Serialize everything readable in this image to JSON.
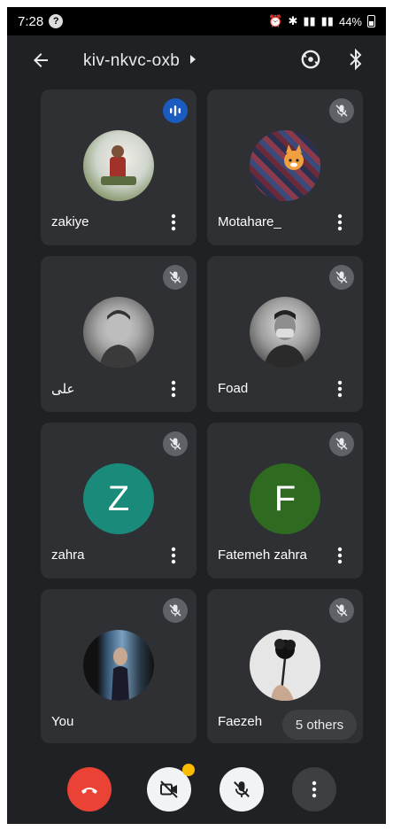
{
  "status_bar": {
    "time": "7:28",
    "notification_glyph": "?",
    "battery": "44%"
  },
  "meeting": {
    "code": "kiv-nkvc-oxb"
  },
  "participants": [
    {
      "name": "zakiye",
      "mic": "speaking",
      "avatar": "photo"
    },
    {
      "name": "Motahare_",
      "mic": "muted",
      "avatar": "photo"
    },
    {
      "name": "علی",
      "mic": "muted",
      "avatar": "photo"
    },
    {
      "name": "Foad",
      "mic": "muted",
      "avatar": "photo"
    },
    {
      "name": "zahra",
      "mic": "muted",
      "avatar": "letter",
      "letter": "Z",
      "color": "#1a8a7a"
    },
    {
      "name": "Fatemeh zahra",
      "mic": "muted",
      "avatar": "letter",
      "letter": "F",
      "color": "#2e6b21"
    },
    {
      "name": "You",
      "mic": "muted",
      "avatar": "photo"
    },
    {
      "name": "Faezeh",
      "mic": "muted",
      "avatar": "photo"
    }
  ],
  "others_label": "5 others",
  "colors": {
    "end_call": "#ea4335",
    "speaking": "#1a5bbf",
    "tile": "#2f3034",
    "background": "#202124",
    "badge": "#fbbc04"
  }
}
